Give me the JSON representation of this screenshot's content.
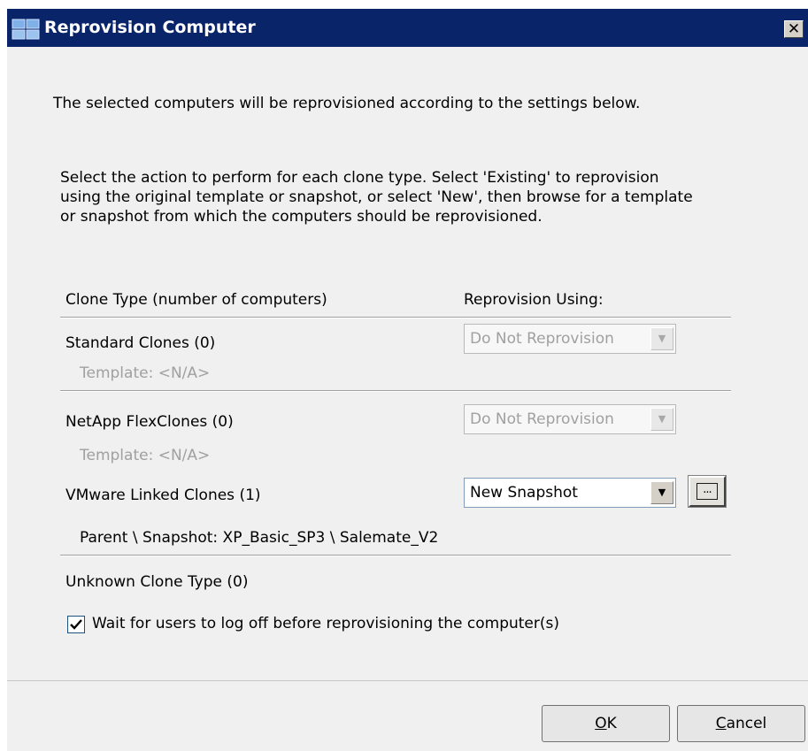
{
  "window": {
    "title": "Reprovision Computer",
    "close_glyph": "✕"
  },
  "intro_text": "The selected computers will be reprovisioned according to the settings below.",
  "instructions": "Select the action to perform for each clone type.  Select 'Existing' to reprovision using the original template or snapshot, or select 'New', then browse for a template or snapshot from which the computers should be reprovisioned.",
  "headers": {
    "clone_type": "Clone Type (number of computers)",
    "reprovision_using": "Reprovision Using:"
  },
  "rows": [
    {
      "name": "Standard Clones (0)",
      "detail": "Template:  <N/A>",
      "selection": "Do Not Reprovision",
      "enabled": false
    },
    {
      "name": "NetApp FlexClones (0)",
      "detail": "Template:  <N/A>",
      "selection": "Do Not Reprovision",
      "enabled": false
    },
    {
      "name": "VMware Linked Clones (1)",
      "detail": "Parent \\ Snapshot:  XP_Basic_SP3 \\ Salemate_V2",
      "selection": "New Snapshot",
      "enabled": true,
      "browse_label": "..."
    },
    {
      "name": "Unknown Clone Type (0)"
    }
  ],
  "wait_option": {
    "label": "Wait for users to log off before reprovisioning the computer(s)",
    "checked": true
  },
  "buttons": {
    "ok_accel": "O",
    "ok_rest": "K",
    "cancel_accel": "C",
    "cancel_rest": "ancel"
  },
  "icons": {
    "title": "computer-icon",
    "close": "close-icon",
    "dropdown": "chevron-down-icon",
    "browse": "browse-icon",
    "check": "checkmark-icon"
  },
  "colors": {
    "titlebar": "#0a246a",
    "dialog_bg": "#f0f0f0",
    "disabled_text": "#a0a0a0"
  }
}
